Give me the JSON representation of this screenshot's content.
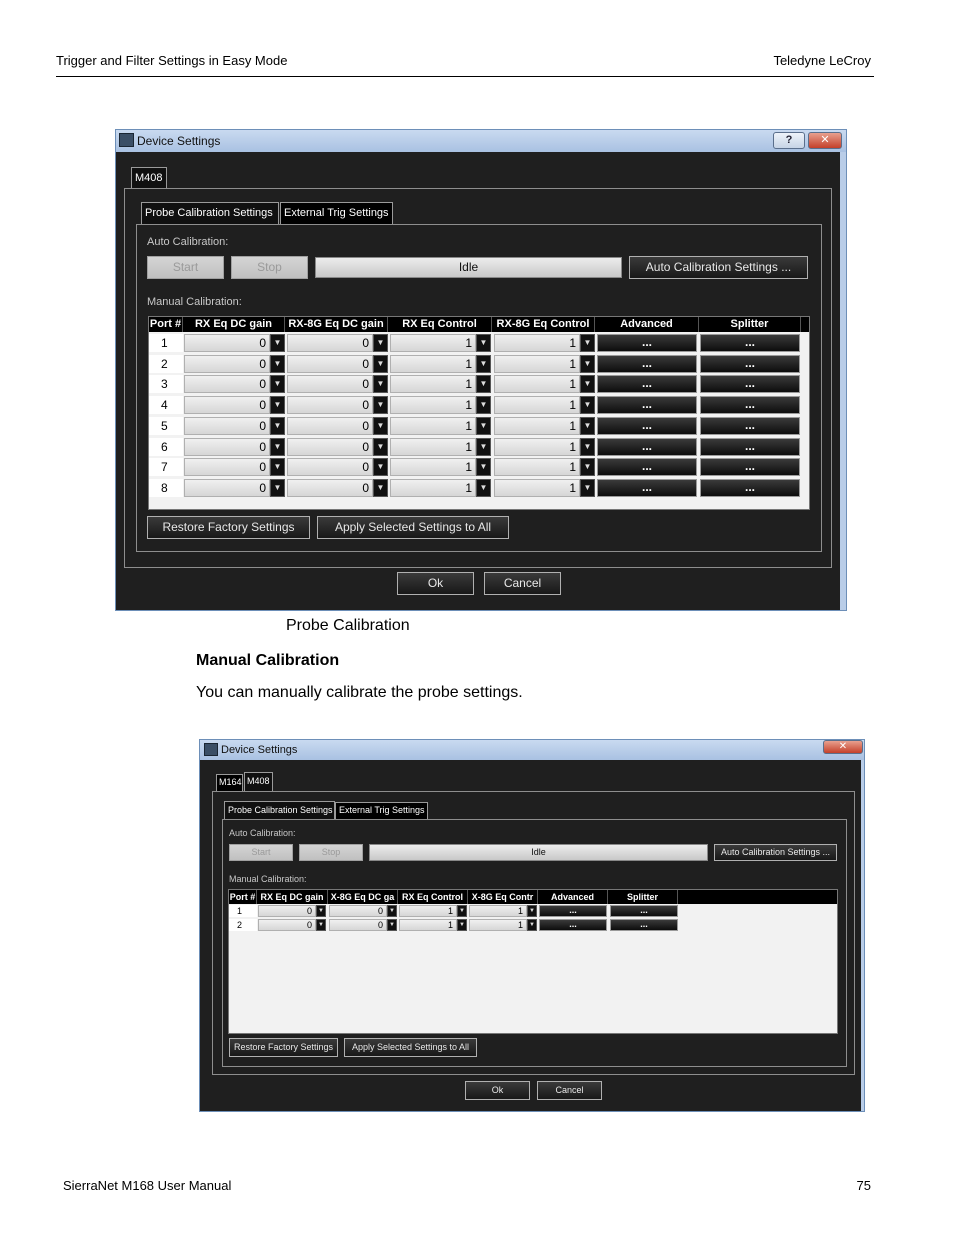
{
  "page_header": {
    "left": "Trigger and Filter Settings in Easy Mode",
    "right": "Teledyne LeCroy"
  },
  "caption": "Probe Calibration",
  "section_heading": "Manual Calibration",
  "body_text": "You can manually calibrate the probe settings.",
  "footer": {
    "left": "SierraNet M168 User Manual",
    "page_number": "75"
  },
  "dialog_common": {
    "window_title": "Device Settings",
    "help_glyph": "?",
    "close_glyph": "✕",
    "tab_probe": "Probe Calibration Settings",
    "tab_external": "External Trig Settings",
    "auto_calibration_label": "Auto Calibration:",
    "start_label": "Start",
    "stop_label": "Stop",
    "status": "Idle",
    "auto_settings_label": "Auto Calibration Settings ...",
    "manual_calibration_label": "Manual Calibration:",
    "restore_label": "Restore Factory Settings",
    "apply_all_label": "Apply Selected Settings to All",
    "ok_label": "Ok",
    "cancel_label": "Cancel",
    "dropdown_glyph": "▼",
    "dots": "...",
    "icons": [
      "app-icon",
      "help-icon",
      "close-icon",
      "dropdown-arrow-icon"
    ]
  },
  "dialog1": {
    "device_tabs": [
      "M408"
    ],
    "columns": [
      "Port #",
      "RX Eq DC gain",
      "RX-8G Eq DC gain",
      "RX Eq Control",
      "RX-8G Eq Control",
      "Advanced",
      "Splitter"
    ],
    "rows": [
      {
        "port": "1",
        "rx_eq_dc_gain": "0",
        "rx8g_eq_dc_gain": "0",
        "rx_eq_control": "1",
        "rx8g_eq_control": "1"
      },
      {
        "port": "2",
        "rx_eq_dc_gain": "0",
        "rx8g_eq_dc_gain": "0",
        "rx_eq_control": "1",
        "rx8g_eq_control": "1"
      },
      {
        "port": "3",
        "rx_eq_dc_gain": "0",
        "rx8g_eq_dc_gain": "0",
        "rx_eq_control": "1",
        "rx8g_eq_control": "1"
      },
      {
        "port": "4",
        "rx_eq_dc_gain": "0",
        "rx8g_eq_dc_gain": "0",
        "rx_eq_control": "1",
        "rx8g_eq_control": "1"
      },
      {
        "port": "5",
        "rx_eq_dc_gain": "0",
        "rx8g_eq_dc_gain": "0",
        "rx_eq_control": "1",
        "rx8g_eq_control": "1"
      },
      {
        "port": "6",
        "rx_eq_dc_gain": "0",
        "rx8g_eq_dc_gain": "0",
        "rx_eq_control": "1",
        "rx8g_eq_control": "1"
      },
      {
        "port": "7",
        "rx_eq_dc_gain": "0",
        "rx8g_eq_dc_gain": "0",
        "rx_eq_control": "1",
        "rx8g_eq_control": "1"
      },
      {
        "port": "8",
        "rx_eq_dc_gain": "0",
        "rx8g_eq_dc_gain": "0",
        "rx_eq_control": "1",
        "rx8g_eq_control": "1"
      }
    ]
  },
  "dialog2": {
    "device_tabs": [
      "M164",
      "M408"
    ],
    "columns": [
      "Port #",
      "RX Eq DC gain",
      "X-8G Eq DC ga",
      "RX Eq Control",
      "X-8G Eq Contr",
      "Advanced",
      "Splitter"
    ],
    "rows": [
      {
        "port": "1",
        "rx_eq_dc_gain": "0",
        "rx8g_eq_dc_gain": "0",
        "rx_eq_control": "1",
        "rx8g_eq_control": "1"
      },
      {
        "port": "2",
        "rx_eq_dc_gain": "0",
        "rx8g_eq_dc_gain": "0",
        "rx_eq_control": "1",
        "rx8g_eq_control": "1"
      }
    ]
  }
}
